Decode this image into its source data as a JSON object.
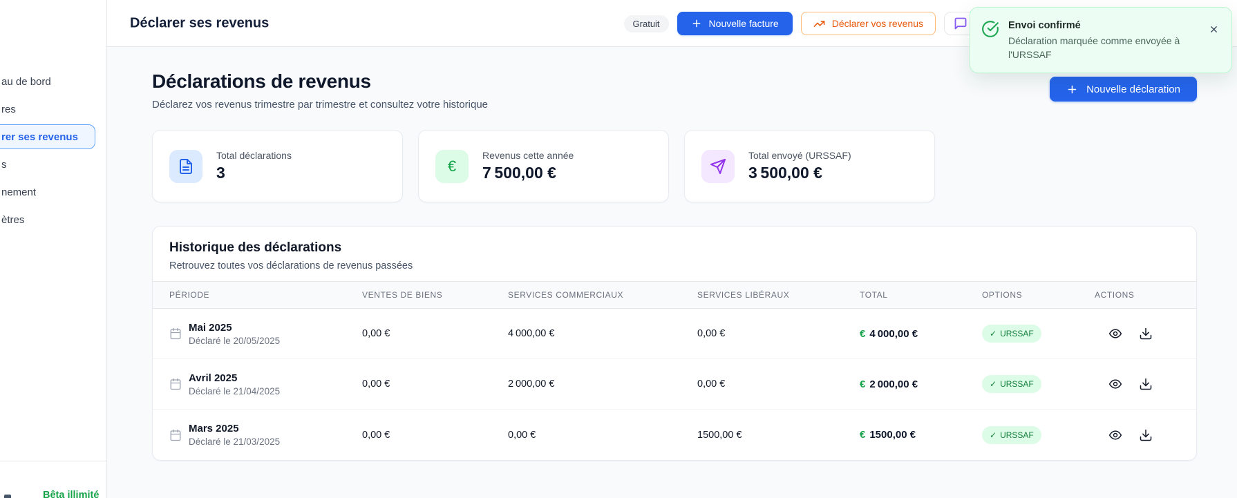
{
  "sidebar": {
    "items": [
      {
        "label": "au de bord",
        "active": false
      },
      {
        "label": "res",
        "active": false
      },
      {
        "label": "rer ses revenus",
        "active": true
      },
      {
        "label": "s",
        "active": false
      },
      {
        "label": "nement",
        "active": false
      },
      {
        "label": "ètres",
        "active": false
      }
    ],
    "footer_badge": "Bêta illimité"
  },
  "header": {
    "title": "Déclarer ses revenus",
    "plan_badge": "Gratuit",
    "new_invoice_button": "Nouvelle facture",
    "declare_button": "Déclarer vos revenus"
  },
  "toast": {
    "title": "Envoi confirmé",
    "message": "Déclaration marquée comme envoyée à l'URSSAF"
  },
  "page": {
    "title": "Déclarations de revenus",
    "subtitle": "Déclarez vos revenus trimestre par trimestre et consultez votre historique",
    "new_declaration_button": "Nouvelle déclaration"
  },
  "stats": [
    {
      "label": "Total déclarations",
      "value": "3",
      "icon": "file-text-icon"
    },
    {
      "label": "Revenus cette année",
      "value": "7 500,00 €",
      "icon": "euro-icon"
    },
    {
      "label": "Total envoyé (URSSAF)",
      "value": "3 500,00 €",
      "icon": "send-icon"
    }
  ],
  "history": {
    "title": "Historique des déclarations",
    "subtitle": "Retrouvez toutes vos déclarations de revenus passées",
    "columns": [
      "PÉRIODE",
      "VENTES DE BIENS",
      "SERVICES COMMERCIAUX",
      "SERVICES LIBÉRAUX",
      "TOTAL",
      "OPTIONS",
      "ACTIONS"
    ],
    "rows": [
      {
        "period": "Mai 2025",
        "declared": "Déclaré le 20/05/2025",
        "ventes": "0,00 €",
        "commerciaux": "4 000,00 €",
        "liberaux": "0,00 €",
        "total": "4 000,00 €",
        "badge": "URSSAF"
      },
      {
        "period": "Avril 2025",
        "declared": "Déclaré le 21/04/2025",
        "ventes": "0,00 €",
        "commerciaux": "2 000,00 €",
        "liberaux": "0,00 €",
        "total": "2 000,00 €",
        "badge": "URSSAF"
      },
      {
        "period": "Mars 2025",
        "declared": "Déclaré le 21/03/2025",
        "ventes": "0,00 €",
        "commerciaux": "0,00 €",
        "liberaux": "1500,00 €",
        "total": "1500,00 €",
        "badge": "URSSAF"
      }
    ]
  },
  "icons": {
    "euro": "€",
    "check": "✓"
  },
  "colors": {
    "accent_blue": "#2563eb",
    "success_green": "#16a34a",
    "badge_green_bg": "#dcfce7",
    "badge_green_text": "#15803d",
    "toast_bg": "#ecfdf3",
    "toast_border": "#bbf7d0",
    "orange": "#ea580c",
    "purple": "#8b5cf6",
    "send_purple": "#9333ea"
  }
}
